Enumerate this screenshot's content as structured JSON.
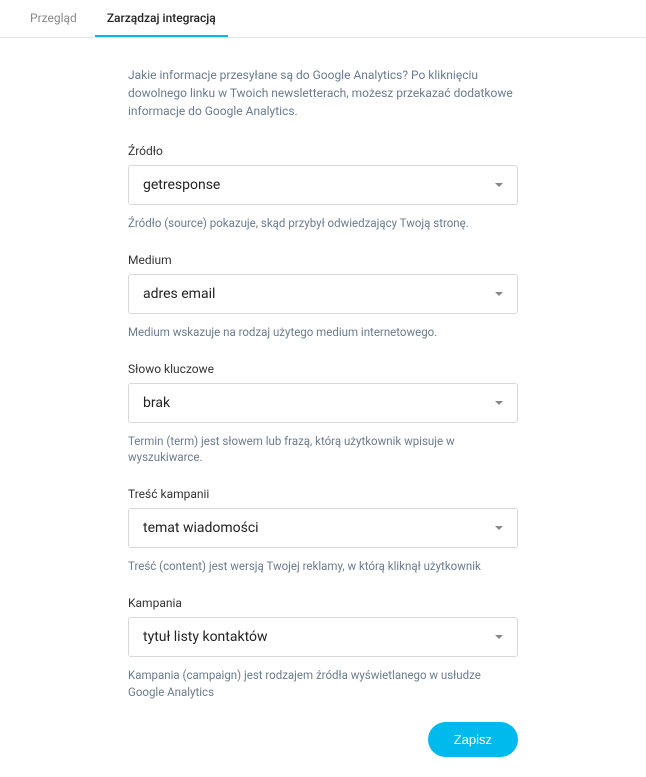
{
  "tabs": {
    "overview": "Przegląd",
    "manage": "Zarządzaj integracją"
  },
  "intro": "Jakie informacje przesyłane są do Google Analytics? Po kliknięciu dowolnego linku w Twoich newsletterach, możesz przekazać dodatkowe informacje do Google Analytics.",
  "fields": {
    "source": {
      "label": "Źródło",
      "value": "getresponse",
      "hint": "Źródło (source) pokazuje, skąd przybył odwiedzający Twoją stronę."
    },
    "medium": {
      "label": "Medium",
      "value": "adres email",
      "hint": "Medium wskazuje na rodzaj użytego medium internetowego."
    },
    "keyword": {
      "label": "Słowo kluczowe",
      "value": "brak",
      "hint": "Termin (term) jest słowem lub frazą, którą użytkownik wpisuje w wyszukiwarce."
    },
    "content": {
      "label": "Treść kampanii",
      "value": "temat wiadomości",
      "hint": "Treść (content) jest wersją Twojej reklamy, w którą kliknął użytkownik"
    },
    "campaign": {
      "label": "Kampania",
      "value": "tytuł listy kontaktów",
      "hint": "Kampania (campaign) jest rodzajem źródła wyświetlanego w usłudze Google Analytics"
    }
  },
  "actions": {
    "save": "Zapisz"
  }
}
